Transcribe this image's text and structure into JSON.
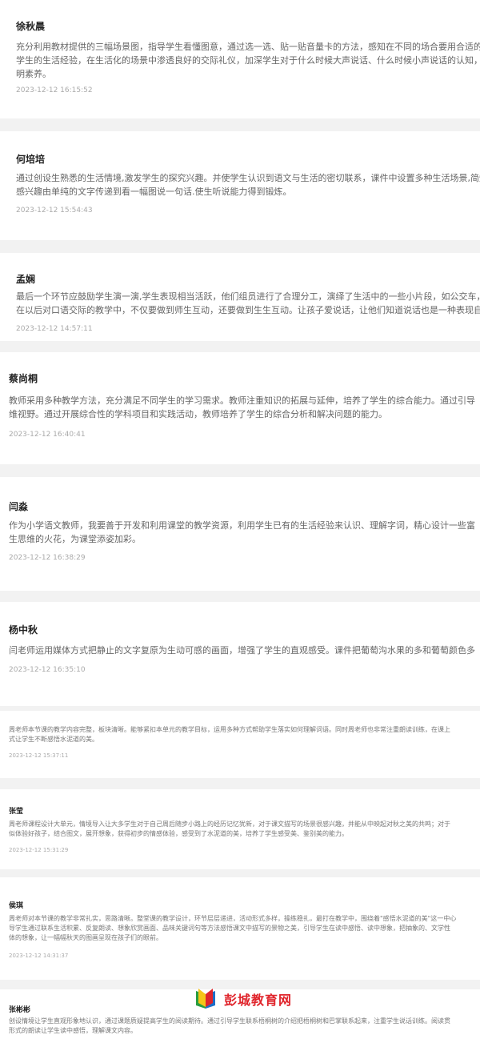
{
  "comments": [
    {
      "name": "徐秋晨",
      "lines": [
        "充分利用教材提供的三幅场景图，指导学生看懂图意，通过选一选、贴一贴音量卡的方法，感知在不同的场合要用合适的音量",
        "学生的生活经验，在生活化的场景中渗透良好的交际礼仪，加深学生对于什么时候大声说话、什么时候小声说话的认知，培养",
        "明素养。"
      ],
      "time": "2023-12-12 16:15:52"
    },
    {
      "name": "何培培",
      "lines": [
        "通过创设生熟悉的生活情境,激发学生的探究兴趣。并使学生认识到语文与生活的密切联系，课件中设置多种生活场景,简短的",
        "感兴趣由单纯的文字传递到看一幅图说一句话.使生听说能力得到锻炼。"
      ],
      "time": "2023-12-12 15:54:43"
    },
    {
      "name": "孟娴",
      "lines": [
        "最后一个环节应鼓励学生演一演,学生表现相当活跃，他们组员进行了合理分工，演绎了生活中的一些小片段，如公交车，",
        "在以后对口语交际的教学中，不仅要做到师生互动，还要做到生生互动。让孩子爱说话，让他们知道说话也是一种表现自己的"
      ],
      "time": "2023-12-12 14:57:11"
    },
    {
      "name": "蔡尚桐",
      "lines": [
        "教师采用多种教学方法，充分满足不同学生的学习需求。教师注重知识的拓展与延伸，培养了学生的综合能力。通过引导",
        "维视野。通过开展综合性的学科项目和实践活动，教师培养了学生的综合分析和解决问题的能力。"
      ],
      "time": "2023-12-12 16:40:41"
    },
    {
      "name": "闫淼",
      "lines": [
        "作为小学语文教师，我要善于开发和利用课堂的教学资源，利用学生已有的生活经验来认识、理解字词，精心设计一些富",
        "生思维的火花，为课堂添姿加彩。"
      ],
      "time": "2023-12-12 16:38:29"
    },
    {
      "name": "杨中秋",
      "lines": [
        "闫老师运用媒体方式把静止的文字复原为生动可感的画面，增强了学生的直观感受。课件把葡萄沟水果的多和葡萄颜色多"
      ],
      "time": "2023-12-12 16:35:10"
    },
    {
      "name": "",
      "lines": [
        "周老师本节课的教学内容完整，板块清晰。能够紧扣本单元的教学目标，运用多种方式帮助学生落实如何理解词语。同时周老师也非常注重朗读训练，在课上",
        "式让学生不断感悟水泥道的美。"
      ],
      "time": "2023-12-12 15:37:11"
    },
    {
      "name": "张莹",
      "lines": [
        "周老师课程设计大单元，情境导入让大多学生对于自己周后随步小路上的经历记忆犹新，对于课文描写的场景很感兴趣，并能从中映起对秋之美的共鸣；对于",
        "似体验好孩子，结合图文，展开想象，获得初步的情感体验，感受到了水泥道的美，培养了学生感受美、鉴别美的能力。"
      ],
      "time": "2023-12-12 15:31:29"
    },
    {
      "name": "侯琪",
      "lines": [
        "周老师对本节课的教学非常扎实，思路清晰。整堂课的教学设计，环节层层递进，活动形式多样，操练稳扎，最打在教学中，围绕着\"感悟水泥道的美\"这一中心",
        "导学生通过联系生活积累、反复朗读、想象欣赏画面、品味关键词句等方法感悟课文中描写的景物之美，引导学生在读中感悟、读中想象，把抽象的、文学性",
        "体的想象，让一幅幅秋天的图画呈现在孩子们的眼前。"
      ],
      "time": "2023-12-12 14:31:37"
    },
    {
      "name": "张彬彬",
      "lines": [
        "创设情境让学生直观形象地认识，通过课题质疑提高学生的阅读期待。通过引导学生联系梧桐树的介绍把梧桐树和巴掌联系起来，注重学生说话训练。阅读贯",
        "形式的朗读让学生读中感悟，理解课文内容。"
      ],
      "time": ""
    }
  ],
  "watermark": {
    "text": "彭城教育网",
    "color": "#e0252c"
  }
}
